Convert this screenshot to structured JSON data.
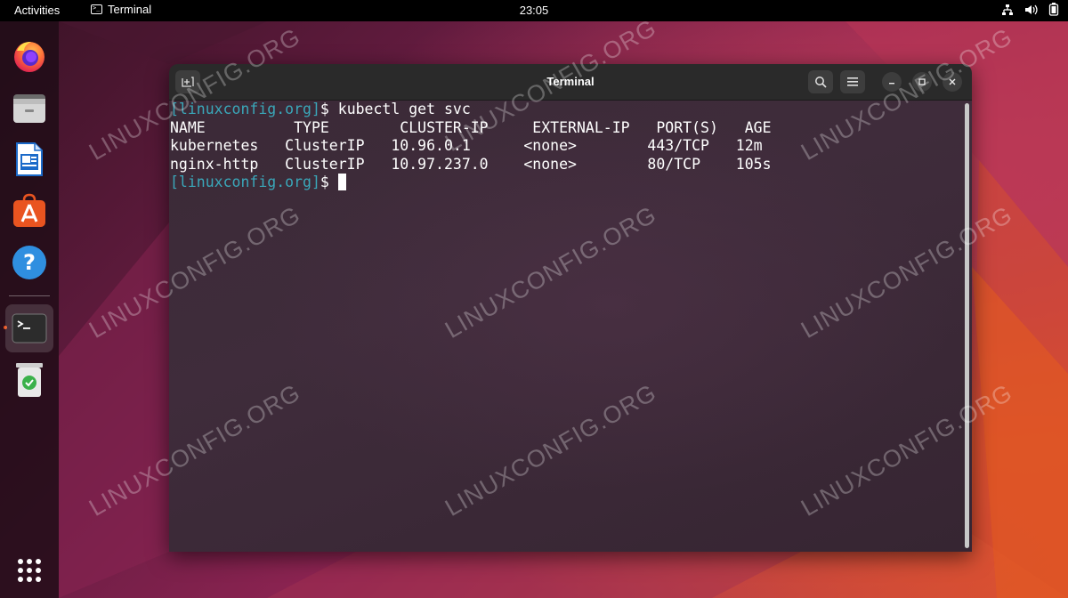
{
  "topbar": {
    "activities": "Activities",
    "app_name": "Terminal",
    "clock": "23:05"
  },
  "dock": {
    "items": [
      {
        "name": "firefox-icon"
      },
      {
        "name": "files-icon"
      },
      {
        "name": "writer-icon"
      },
      {
        "name": "software-icon"
      },
      {
        "name": "help-icon"
      },
      {
        "name": "terminal-icon"
      },
      {
        "name": "trash-icon"
      },
      {
        "name": "show-apps-icon"
      }
    ]
  },
  "window": {
    "title": "Terminal"
  },
  "terminal": {
    "prompt": "[linuxconfig.org]",
    "line1_cmd": "$ kubectl get svc",
    "header": "NAME          TYPE        CLUSTER-IP     EXTERNAL-IP   PORT(S)   AGE",
    "row1": "kubernetes   ClusterIP   10.96.0.1      <none>        443/TCP   12m",
    "row2": "nginx-http   ClusterIP   10.97.237.0    <none>        80/TCP    105s",
    "line4_suffix": "$ "
  },
  "watermark": "LINUXCONFIG.ORG",
  "colors": {
    "prompt": "#3aa7b9",
    "terminal_bg": "#3b2a37",
    "accent": "#e95420"
  }
}
